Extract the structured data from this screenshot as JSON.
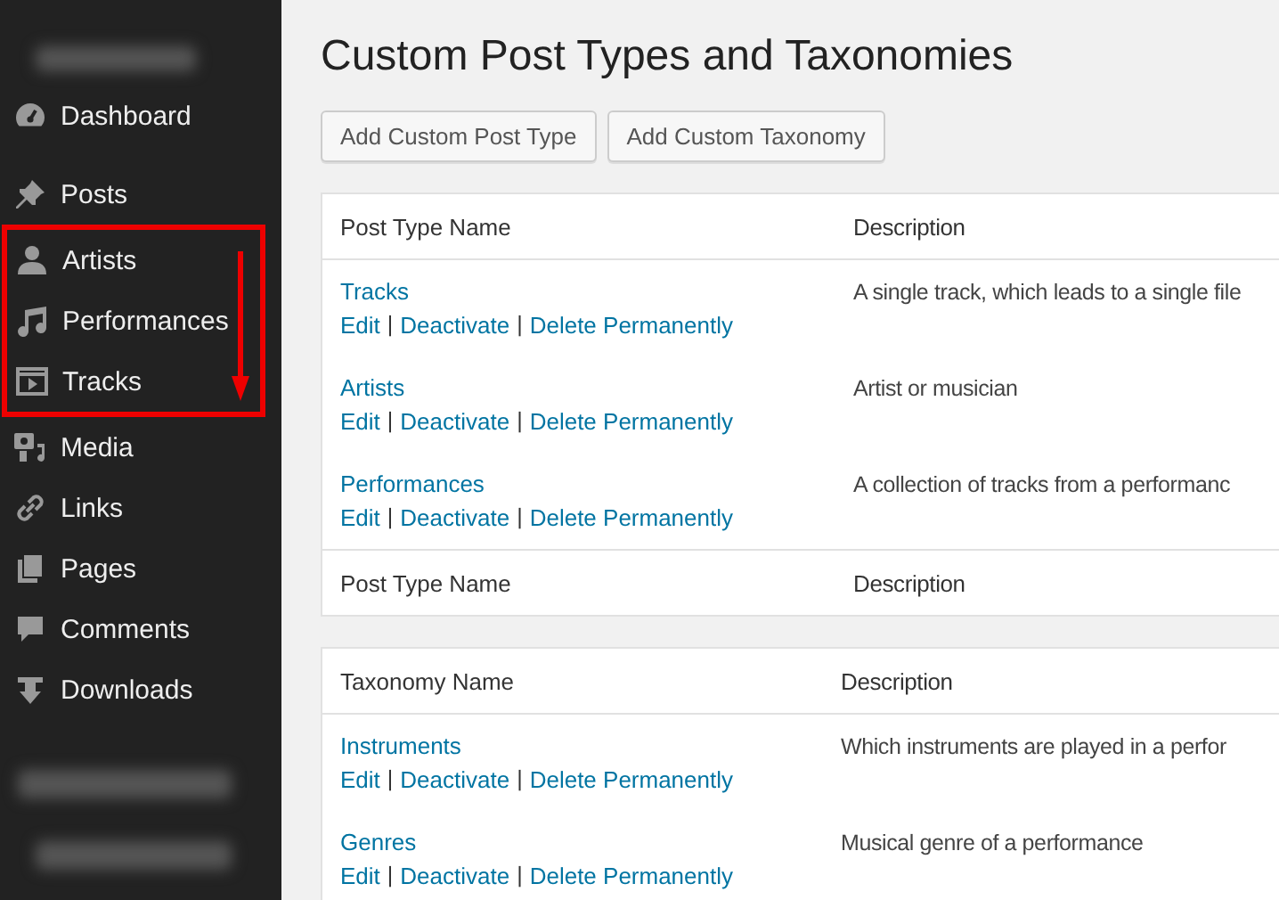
{
  "sidebar": {
    "items": [
      {
        "label": "Dashboard",
        "highlighted": false
      },
      {
        "label": "Posts",
        "highlighted": false
      },
      {
        "label": "Artists",
        "highlighted": true
      },
      {
        "label": "Performances",
        "highlighted": true
      },
      {
        "label": "Tracks",
        "highlighted": true
      },
      {
        "label": "Media",
        "highlighted": false
      },
      {
        "label": "Links",
        "highlighted": false
      },
      {
        "label": "Pages",
        "highlighted": false
      },
      {
        "label": "Comments",
        "highlighted": false
      },
      {
        "label": "Downloads",
        "highlighted": false
      }
    ]
  },
  "action_separator": "|",
  "page": {
    "title": "Custom Post Types and Taxonomies",
    "buttons": [
      "Add Custom Post Type",
      "Add Custom Taxonomy"
    ]
  },
  "tables": [
    {
      "columns": [
        "Post Type Name",
        "Description"
      ],
      "footer_columns": [
        "Post Type Name",
        "Description"
      ],
      "rows": [
        {
          "name": "Tracks",
          "actions": [
            "Edit",
            "Deactivate",
            "Delete Permanently"
          ],
          "description": "A single track, which leads to a single file"
        },
        {
          "name": "Artists",
          "actions": [
            "Edit",
            "Deactivate",
            "Delete Permanently"
          ],
          "description": "Artist or musician"
        },
        {
          "name": "Performances",
          "actions": [
            "Edit",
            "Deactivate",
            "Delete Permanently"
          ],
          "description": "A collection of tracks from a performanc"
        }
      ]
    },
    {
      "columns": [
        "Taxonomy Name",
        "Description"
      ],
      "rows": [
        {
          "name": "Instruments",
          "actions": [
            "Edit",
            "Deactivate",
            "Delete Permanently"
          ],
          "description": "Which instruments are played in a perfor"
        },
        {
          "name": "Genres",
          "actions": [
            "Edit",
            "Deactivate",
            "Delete Permanently"
          ],
          "description": "Musical genre of a performance"
        }
      ]
    }
  ]
}
